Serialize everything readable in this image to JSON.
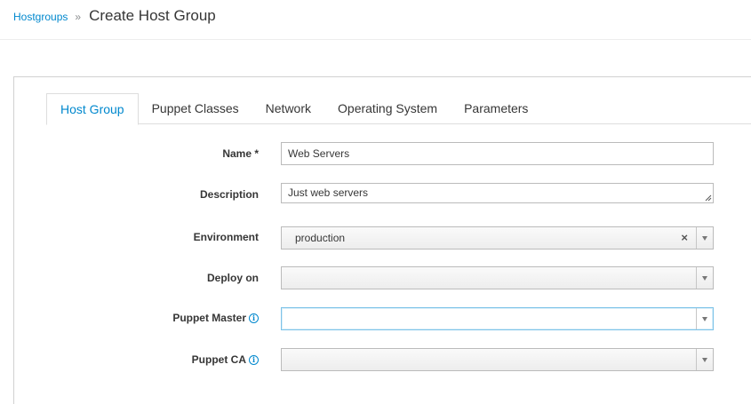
{
  "breadcrumb": {
    "parent": "Hostgroups",
    "separator": "»",
    "current": "Create Host Group"
  },
  "tabs": [
    {
      "label": "Host Group",
      "active": true
    },
    {
      "label": "Puppet Classes",
      "active": false
    },
    {
      "label": "Network",
      "active": false
    },
    {
      "label": "Operating System",
      "active": false
    },
    {
      "label": "Parameters",
      "active": false
    }
  ],
  "form": {
    "name": {
      "label": "Name *",
      "value": "Web Servers"
    },
    "description": {
      "label": "Description",
      "value": "Just web servers"
    },
    "environment": {
      "label": "Environment",
      "value": "production"
    },
    "deploy_on": {
      "label": "Deploy on",
      "value": ""
    },
    "puppet_master": {
      "label": "Puppet Master",
      "value": ""
    },
    "puppet_ca": {
      "label": "Puppet CA",
      "value": ""
    }
  },
  "icons": {
    "info": "info-circle-icon",
    "clear": "close-icon",
    "dropdown": "caret-down-icon"
  },
  "colors": {
    "link": "#0088ce",
    "focus_border": "#7dc3e8"
  }
}
